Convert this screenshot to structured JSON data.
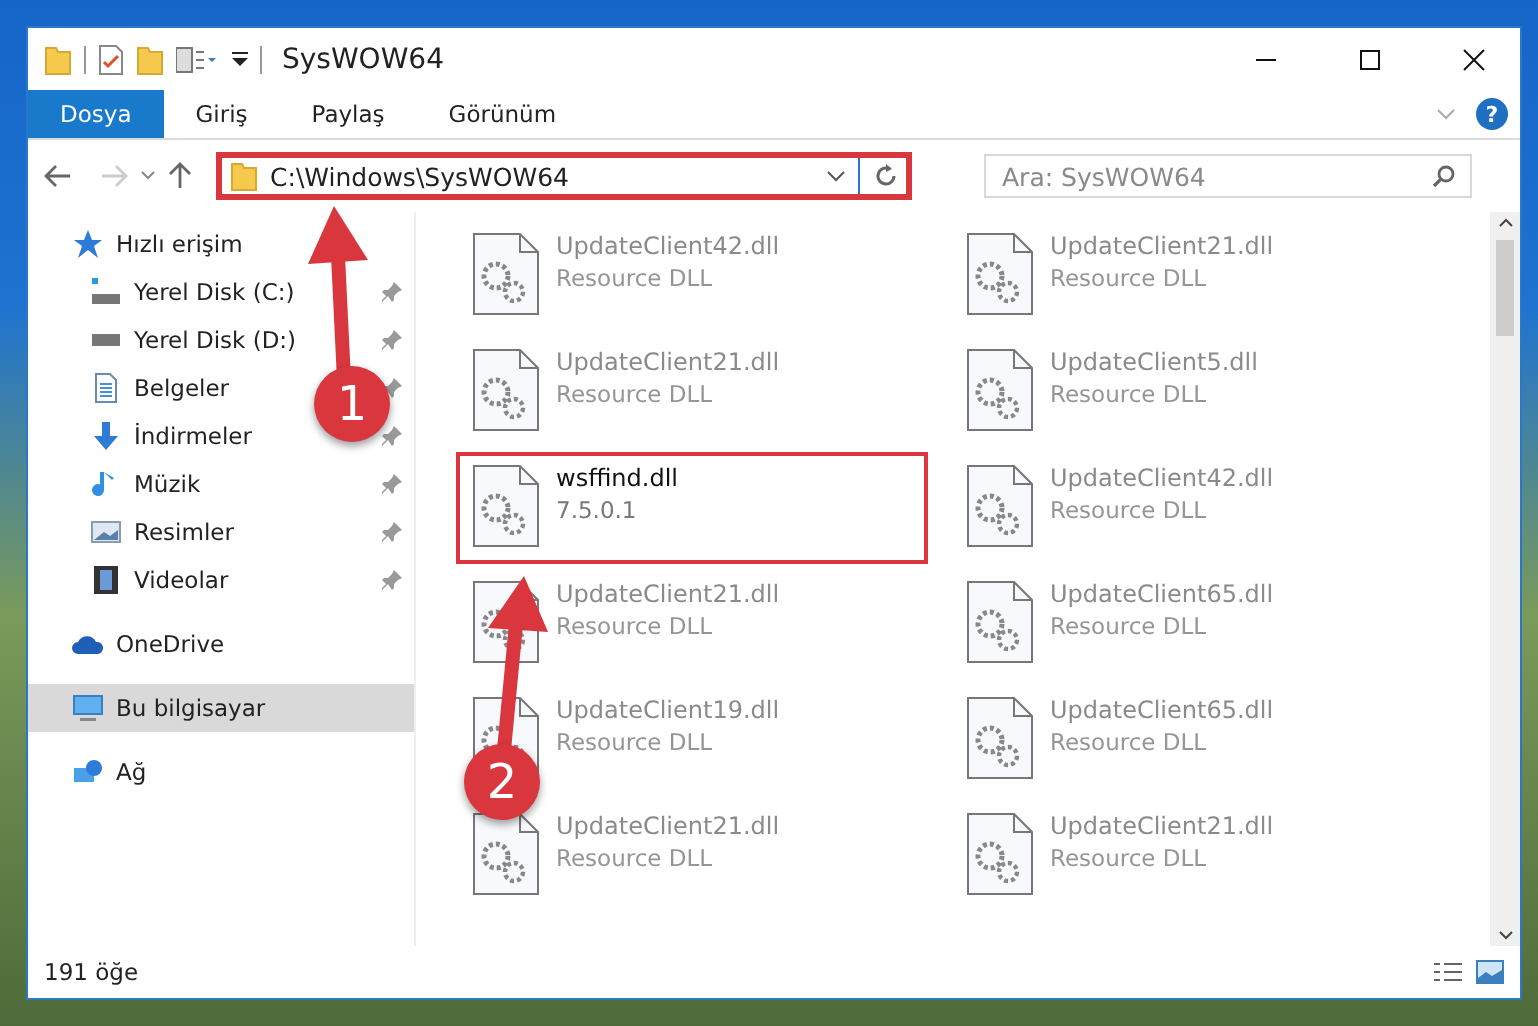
{
  "window": {
    "title": "SysWOW64"
  },
  "ribbon_tabs": [
    {
      "label": "Dosya",
      "selected": true
    },
    {
      "label": "Giriş",
      "selected": false
    },
    {
      "label": "Paylaş",
      "selected": false
    },
    {
      "label": "Görünüm",
      "selected": false
    }
  ],
  "help": {
    "label": "?"
  },
  "address": {
    "value": "C:\\Windows\\SysWOW64",
    "highlighted": true
  },
  "search": {
    "placeholder": "Ara: SysWOW64"
  },
  "sidebar": {
    "items": [
      {
        "label": "Hızlı erişim",
        "pinned": false,
        "selected": false,
        "sub": false
      },
      {
        "label": "Yerel Disk (C:)",
        "pinned": true,
        "selected": false,
        "sub": true
      },
      {
        "label": "Yerel Disk (D:)",
        "pinned": true,
        "selected": false,
        "sub": true
      },
      {
        "label": "Belgeler",
        "pinned": true,
        "selected": false,
        "sub": true
      },
      {
        "label": "İndirmeler",
        "pinned": true,
        "selected": false,
        "sub": true
      },
      {
        "label": "Müzik",
        "pinned": true,
        "selected": false,
        "sub": true
      },
      {
        "label": "Resimler",
        "pinned": true,
        "selected": false,
        "sub": true
      },
      {
        "label": "Videolar",
        "pinned": true,
        "selected": false,
        "sub": true
      },
      {
        "label": "OneDrive",
        "pinned": false,
        "selected": false,
        "sub": false
      },
      {
        "label": "Bu bilgisayar",
        "pinned": false,
        "selected": true,
        "sub": false
      },
      {
        "label": "Ağ",
        "pinned": false,
        "selected": false,
        "sub": false
      }
    ]
  },
  "files": [
    {
      "name": "UpdateClient42.dll",
      "detail": "Resource DLL",
      "dimmed": true,
      "highlighted": false
    },
    {
      "name": "UpdateClient21.dll",
      "detail": "Resource DLL",
      "dimmed": true,
      "highlighted": false
    },
    {
      "name": "UpdateClient21.dll",
      "detail": "Resource DLL",
      "dimmed": true,
      "highlighted": false
    },
    {
      "name": "UpdateClient5.dll",
      "detail": "Resource DLL",
      "dimmed": true,
      "highlighted": false
    },
    {
      "name": "wsffind.dll",
      "detail": "7.5.0.1",
      "dimmed": false,
      "highlighted": true
    },
    {
      "name": "UpdateClient42.dll",
      "detail": "Resource DLL",
      "dimmed": true,
      "highlighted": false
    },
    {
      "name": "UpdateClient21.dll",
      "detail": "Resource DLL",
      "dimmed": true,
      "highlighted": false
    },
    {
      "name": "UpdateClient65.dll",
      "detail": "Resource DLL",
      "dimmed": true,
      "highlighted": false
    },
    {
      "name": "UpdateClient19.dll",
      "detail": "Resource DLL",
      "dimmed": true,
      "highlighted": false
    },
    {
      "name": "UpdateClient65.dll",
      "detail": "Resource DLL",
      "dimmed": true,
      "highlighted": false
    },
    {
      "name": "UpdateClient21.dll",
      "detail": "Resource DLL",
      "dimmed": true,
      "highlighted": false
    },
    {
      "name": "UpdateClient21.dll",
      "detail": "Resource DLL",
      "dimmed": true,
      "highlighted": false
    }
  ],
  "status_bar": {
    "count": "191 öğe"
  },
  "annotations": [
    {
      "label": "1"
    },
    {
      "label": "2"
    }
  ]
}
